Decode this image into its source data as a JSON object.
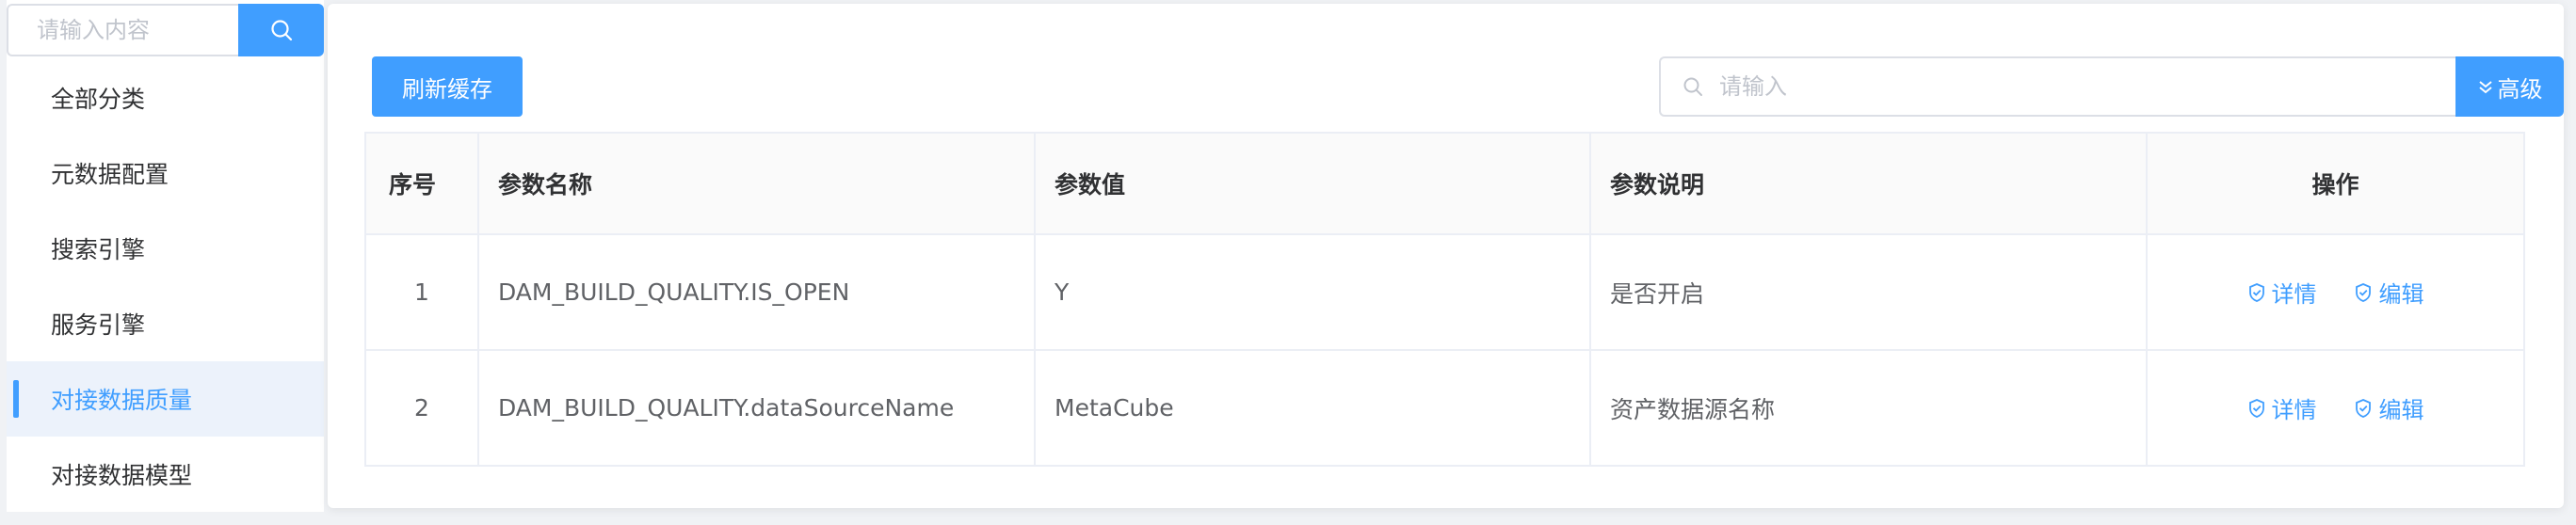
{
  "sidebar": {
    "search": {
      "placeholder": "请输入内容",
      "button_icon": "search-icon"
    },
    "items": [
      {
        "label": "全部分类",
        "active": false
      },
      {
        "label": "元数据配置",
        "active": false
      },
      {
        "label": "搜索引擎",
        "active": false
      },
      {
        "label": "服务引擎",
        "active": false
      },
      {
        "label": "对接数据质量",
        "active": true
      },
      {
        "label": "对接数据模型",
        "active": false
      }
    ]
  },
  "toolbar": {
    "refresh_label": "刷新缓存",
    "search_placeholder": "请输入",
    "advanced_label": "高级"
  },
  "table": {
    "columns": [
      "序号",
      "参数名称",
      "参数值",
      "参数说明",
      "操作"
    ],
    "rows": [
      {
        "index": "1",
        "name": "DAM_BUILD_QUALITY.IS_OPEN",
        "value": "Y",
        "desc": "是否开启",
        "detail": "详情",
        "edit": "编辑"
      },
      {
        "index": "2",
        "name": "DAM_BUILD_QUALITY.dataSourceName",
        "value": "MetaCube",
        "desc": "资产数据源名称",
        "detail": "详情",
        "edit": "编辑"
      }
    ]
  },
  "colors": {
    "primary": "#409eff",
    "active_bg": "#ecf2fb",
    "border": "#ebeef5",
    "header_bg": "#fafafa"
  }
}
